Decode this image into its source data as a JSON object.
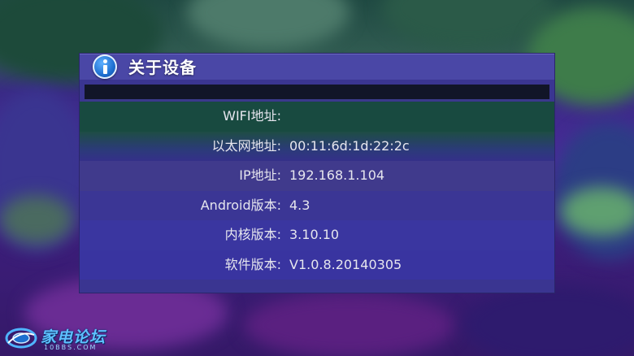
{
  "dialog": {
    "title": "关于设备",
    "icon": "info-icon"
  },
  "rows": [
    {
      "label": "WIFI地址:",
      "value": ""
    },
    {
      "label": "以太网地址:",
      "value": "00:11:6d:1d:22:2c"
    },
    {
      "label": "IP地址:",
      "value": "192.168.1.104"
    },
    {
      "label": "Android版本:",
      "value": "4.3"
    },
    {
      "label": "内核版本:",
      "value": "3.10.10"
    },
    {
      "label": "软件版本:",
      "value": "V1.0.8.20140305"
    }
  ],
  "watermark": {
    "text": "家电论坛",
    "subtext": "10BBS.COM"
  },
  "colors": {
    "dialog_background": "#3a3591",
    "header_background": "#4a47a6",
    "text": "#e6e6ee",
    "icon_blue": "#1e6fd0"
  }
}
